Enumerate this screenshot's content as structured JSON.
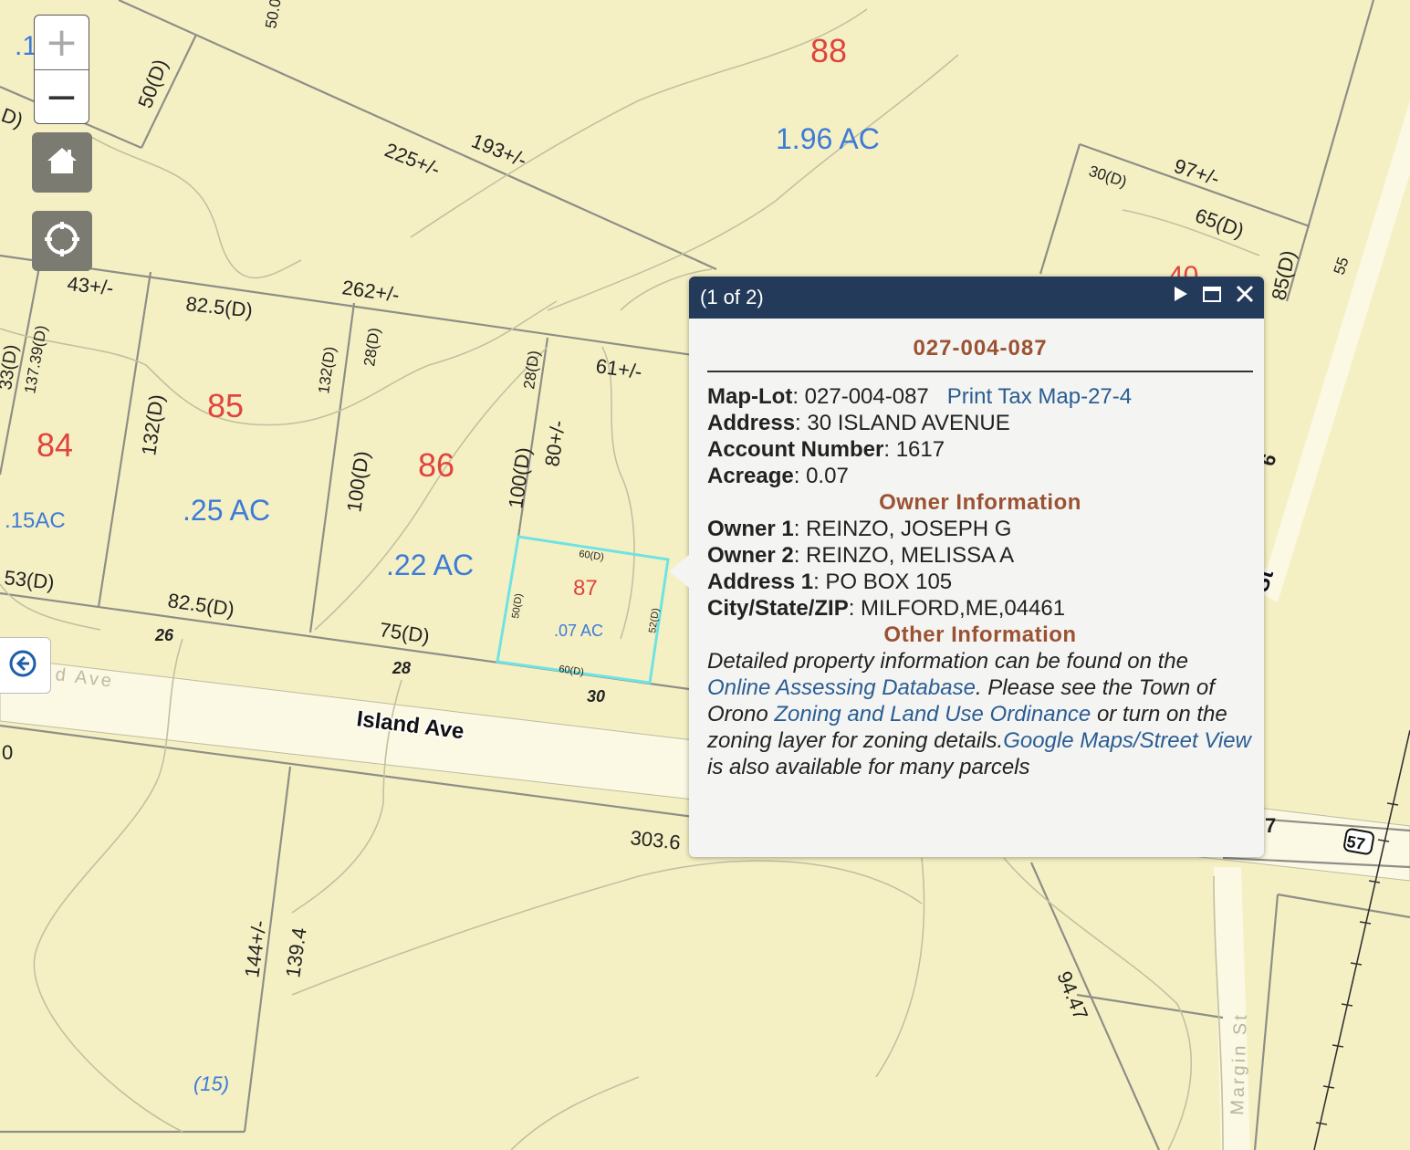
{
  "map": {
    "parcel_numbers": {
      "p88": "88",
      "p84": "84",
      "p85": "85",
      "p86": "86",
      "p87": "87",
      "p40": "40"
    },
    "acreage_labels": {
      "a88": "1.96 AC",
      "a85": ".25 AC",
      "a86": ".22 AC",
      "a84": ".15AC",
      "a87": ".07 AC",
      "a15": "(15)",
      "top_left": ".1"
    },
    "dimensions": {
      "d1": "225+/-",
      "d2": "193+/-",
      "d3": "50(D)",
      "d4": "97+/-",
      "d5": "30(D)",
      "d6": "65(D)",
      "d7": "43+/-",
      "d8": "82.5(D)",
      "d9": "262+/-",
      "d10": "61+/-",
      "d11": "132(D)",
      "d12": "28(D)",
      "d13": "137.39(D)",
      "d14": "132(D)",
      "d15": "100(D)",
      "d16": "28(D)",
      "d17": "100(D)",
      "d18": "80+/-",
      "d19": "53(D)",
      "d20": "82.5(D)",
      "d21": "75(D)",
      "d22": "303.6",
      "d23": "144+/-",
      "d24": "139.4",
      "d25": "94.47",
      "d26": "85(D)",
      "d27": "55",
      "d28": "60(D)",
      "d29": "50(D)",
      "d30": "52(D)",
      "d31": "60(D)",
      "d32": "50.0",
      "d33": "D)",
      "d34": "0",
      "d35": "6",
      "d36": "7",
      "d37": "33(D)"
    },
    "house_numbers": {
      "h26": "26",
      "h28": "28",
      "h30": "30",
      "h57": "57"
    },
    "streets": {
      "island_ave": "Island Ave",
      "island_ave_faded": "d Ave",
      "margin_st": "Margin St",
      "st_fragment": "St"
    }
  },
  "controls": {
    "zoom_in": "+",
    "zoom_out": "−",
    "home_icon": "home-icon",
    "locate_icon": "locate-icon",
    "back_icon": "arrow-left-icon"
  },
  "popup": {
    "counter": "(1 of 2)",
    "title": "027-004-087",
    "fields": {
      "map_lot_label": "Map-Lot",
      "map_lot_value": "027-004-087",
      "print_link": "Print Tax Map-27-4",
      "address_label": "Address",
      "address_value": "30 ISLAND AVENUE",
      "account_label": "Account Number",
      "account_value": "1617",
      "acreage_label": "Acreage",
      "acreage_value": "0.07"
    },
    "owner_heading": "Owner Information",
    "owner": {
      "owner1_label": "Owner 1",
      "owner1_value": "REINZO, JOSEPH G",
      "owner2_label": "Owner 2",
      "owner2_value": "REINZO, MELISSA A",
      "addr1_label": "Address 1",
      "addr1_value": "PO BOX 105",
      "city_label": "City/State/ZIP",
      "city_value": "MILFORD,ME,04461"
    },
    "other_heading": "Other Information",
    "other": {
      "t1": "Detailed property information can be found on the ",
      "link1": "Online Assessing Database",
      "t2": ". Please see the Town of Orono ",
      "link2": "Zoning and Land Use Ordinance",
      "t3": " or turn on the zoning layer for zoning details.",
      "link3": "Google Maps/Street View",
      "t4": " is also available for many parcels"
    },
    "colors": {
      "header": "#233a5a",
      "heading": "#9b5233",
      "link": "#2a5d93",
      "selection": "#6fe3e3"
    }
  }
}
